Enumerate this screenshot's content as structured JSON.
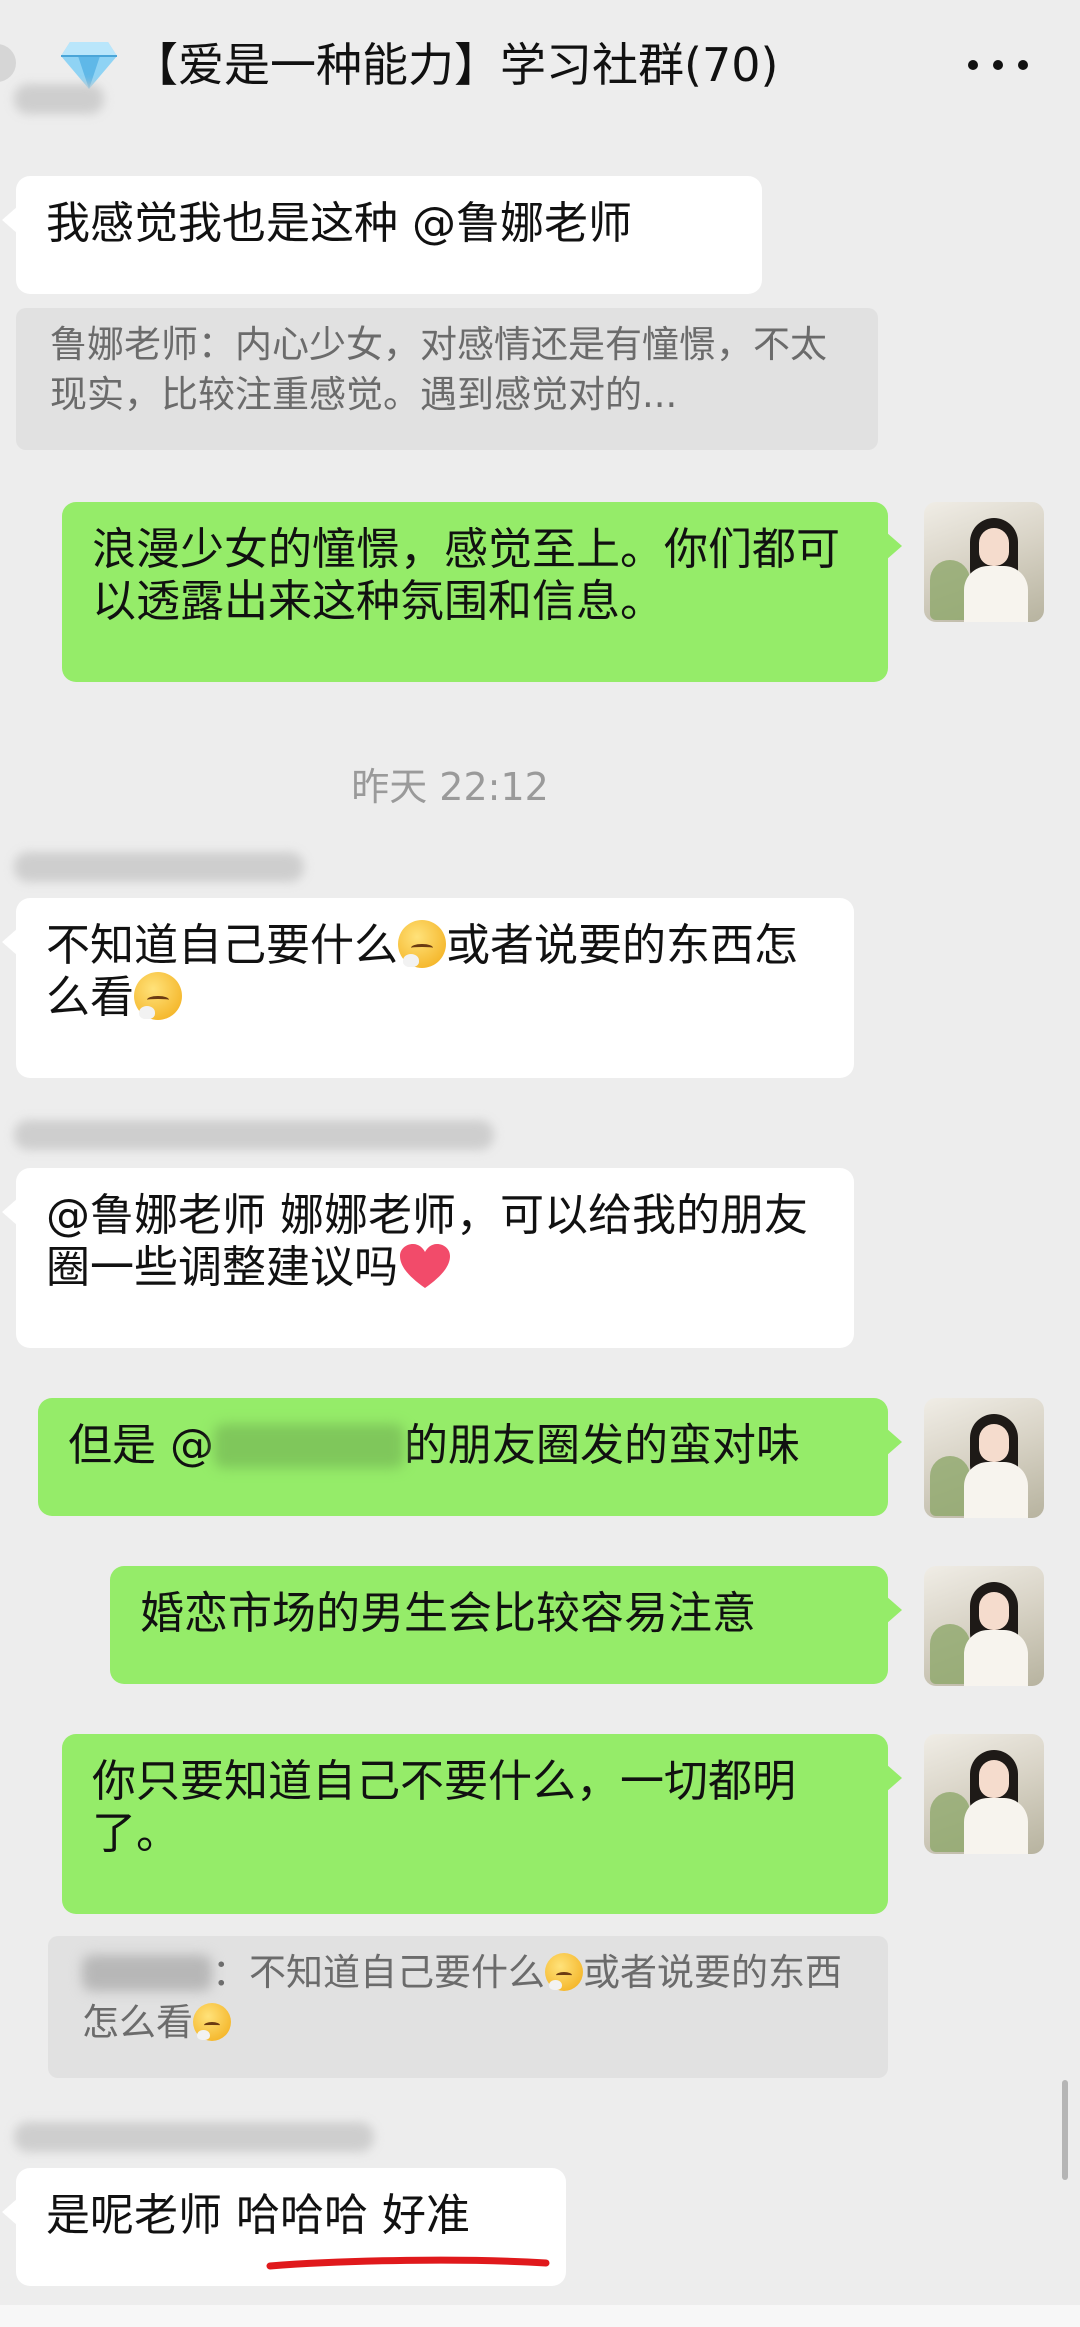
{
  "header": {
    "title": "【爱是一种能力】学习社群(70)",
    "icon": "diamond-icon",
    "more_icon": "more-dots-icon"
  },
  "messages": [
    {
      "text": "我感觉我也是这种 @鲁娜老师"
    },
    {
      "quote": "鲁娜老师：内心少女，对感情还是有憧憬，不太现实，比较注重感觉。遇到感觉对的..."
    },
    {
      "text": "浪漫少女的憧憬，感觉至上。你们都可以透露出来这种氛围和信息。"
    },
    {
      "timestamp": "昨天 22:12"
    },
    {
      "text_a": "不知道自己要什么",
      "text_b": "或者说要的东西怎么看"
    },
    {
      "text_a": "@鲁娜老师 娜娜老师，可以给我的朋友圈一些调整建议吗"
    },
    {
      "text_a": "但是 @",
      "text_b": "的朋友圈发的蛮对味"
    },
    {
      "text": "婚恋市场的男生会比较容易注意"
    },
    {
      "text": "你只要知道自己不要什么，一切都明了。"
    },
    {
      "quote_a": "：不知道自己要什么",
      "quote_b": "或者说要的东西怎么看"
    },
    {
      "text_a": "是呢老师 ",
      "text_b": "哈哈哈 好准"
    }
  ],
  "colors": {
    "background": "#ededed",
    "bubble_self": "#95ec69",
    "bubble_other": "#ffffff",
    "underline": "#e0191c"
  },
  "emoji": "worried-face-emoji",
  "heart": "red-heart-icon"
}
